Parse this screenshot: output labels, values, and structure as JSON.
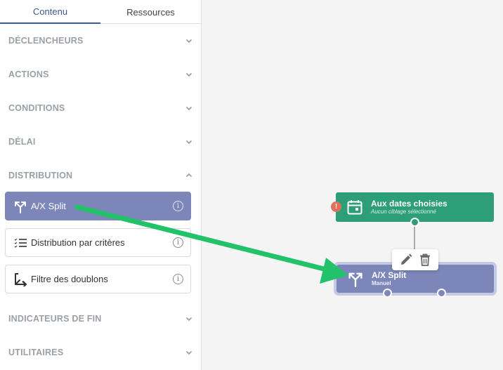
{
  "tabs": [
    {
      "label": "Contenu",
      "active": true
    },
    {
      "label": "Ressources",
      "active": false
    }
  ],
  "sections": [
    {
      "label": "DÉCLENCHEURS",
      "expanded": false
    },
    {
      "label": "ACTIONS",
      "expanded": false
    },
    {
      "label": "CONDITIONS",
      "expanded": false
    },
    {
      "label": "DÉLAI",
      "expanded": false
    },
    {
      "label": "DISTRIBUTION",
      "expanded": true
    },
    {
      "label": "INDICATEURS DE FIN",
      "expanded": false
    },
    {
      "label": "UTILITAIRES",
      "expanded": false
    }
  ],
  "distribution_items": [
    {
      "label": "A/X Split",
      "icon": "split-icon",
      "active": true
    },
    {
      "label": "Distribution par critères",
      "icon": "list-criteria-icon",
      "active": false
    },
    {
      "label": "Filtre des doublons",
      "icon": "merge-filter-icon",
      "active": false
    }
  ],
  "canvas": {
    "trigger_node": {
      "title": "Aux dates choisies",
      "subtitle": "Aucun ciblage sélectionné",
      "icon": "calendar-icon",
      "warning": "!"
    },
    "split_node": {
      "title": "A/X Split",
      "subtitle": "Manuel",
      "icon": "split-icon"
    },
    "toolbar": {
      "edit_icon": "pencil-icon",
      "delete_icon": "trash-icon"
    }
  },
  "colors": {
    "accent": "#3d5a8a",
    "item_active": "#7c86b8",
    "trigger_node": "#2e9e78",
    "arrow": "#22c26a",
    "warning": "#e0705a"
  }
}
